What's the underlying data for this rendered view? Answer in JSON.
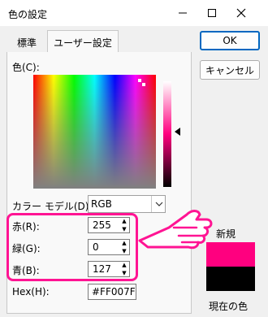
{
  "window": {
    "title": "色の設定"
  },
  "tabs": [
    {
      "label": "標準",
      "active": false
    },
    {
      "label": "ユーザー設定",
      "active": true
    }
  ],
  "buttons": {
    "ok": "OK",
    "cancel": "キャンセル"
  },
  "color_label": "色(C):",
  "color_model": {
    "label": "カラー モデル(D):",
    "value": "RGB"
  },
  "rgb": {
    "r_label": "赤(R):",
    "r_value": "255",
    "g_label": "緑(G):",
    "g_value": "0",
    "b_label": "青(B):",
    "b_value": "127"
  },
  "hex": {
    "label": "Hex(H):",
    "value": "#FF007F"
  },
  "preview": {
    "new_label": "新規",
    "current_label": "現在の色",
    "new_color": "#FF007F",
    "current_color": "#000000"
  },
  "colors": {
    "highlight": "#FF1493",
    "accent": "#0067C0"
  },
  "icons": [
    "minimize-icon",
    "maximize-icon",
    "close-icon",
    "chevron-down-icon",
    "spin-up-icon",
    "spin-down-icon",
    "pointing-hand-icon"
  ]
}
